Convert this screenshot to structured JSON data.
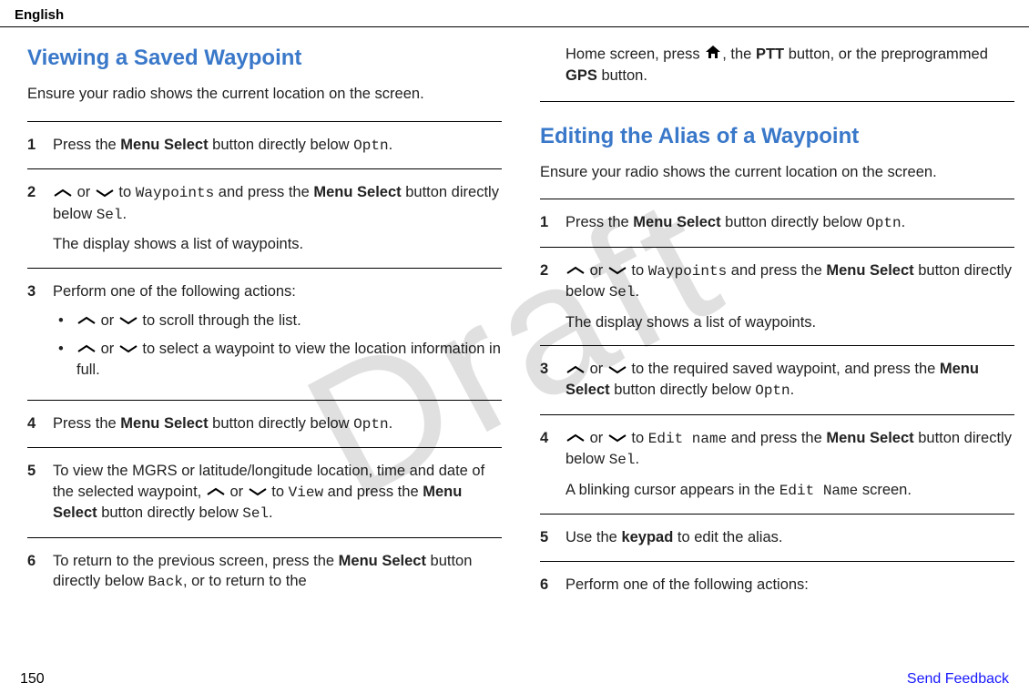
{
  "header": "English",
  "watermark": "Draft",
  "page_number": "150",
  "feedback_link": "Send Feedback",
  "left": {
    "title": "Viewing a Saved Waypoint",
    "intro": "Ensure your radio shows the current location on the screen.",
    "steps": {
      "s1": {
        "num": "1",
        "a1": "Press the ",
        "b1": "Menu Select",
        "a2": " button directly below ",
        "m1": "Optn",
        "a3": "."
      },
      "s2": {
        "num": "2",
        "a1": " or ",
        "a2": " to ",
        "m1": "Waypoints",
        "a3": " and press the ",
        "b1": "Menu Select",
        "a4": " button directly below ",
        "m2": "Sel",
        "a5": ".",
        "sub": "The display shows a list of waypoints."
      },
      "s3": {
        "num": "3",
        "intro": "Perform one of the following actions:",
        "b1a": " or ",
        "b1b": " to scroll through the list.",
        "b2a": " or ",
        "b2b": " to select a waypoint to view the location information in full."
      },
      "s4": {
        "num": "4",
        "a1": "Press the ",
        "b1": "Menu Select",
        "a2": " button directly below ",
        "m1": "Optn",
        "a3": "."
      },
      "s5": {
        "num": "5",
        "a1": "To view the MGRS or latitude/longitude location, time and date of the selected waypoint, ",
        "a2": " or ",
        "a3": " to ",
        "m1": "View",
        "a4": " and press the ",
        "b1": "Menu Select",
        "a5": " button directly below ",
        "m2": "Sel",
        "a6": "."
      },
      "s6": {
        "num": "6",
        "a1": "To return to the previous screen, press the ",
        "b1": "Menu Select",
        "a2": " button directly below ",
        "m1": "Back",
        "a3": ", or to return to the"
      }
    }
  },
  "right": {
    "cont": {
      "a1": "Home screen, press ",
      "a2": ", the ",
      "b1": "PTT",
      "a3": " button, or the preprogrammed ",
      "b2": "GPS",
      "a4": " button."
    },
    "title": "Editing the Alias of a Waypoint",
    "intro": "Ensure your radio shows the current location on the screen.",
    "steps": {
      "s1": {
        "num": "1",
        "a1": "Press the ",
        "b1": "Menu Select",
        "a2": " button directly below ",
        "m1": "Optn",
        "a3": "."
      },
      "s2": {
        "num": "2",
        "a1": " or ",
        "a2": " to ",
        "m1": "Waypoints",
        "a3": " and press the ",
        "b1": "Menu Select",
        "a4": " button directly below ",
        "m2": "Sel",
        "a5": ".",
        "sub": "The display shows a list of waypoints."
      },
      "s3": {
        "num": "3",
        "a1": " or ",
        "a2": " to the required saved waypoint, and press the ",
        "b1": "Menu Select",
        "a3": " button directly below ",
        "m1": "Optn",
        "a4": "."
      },
      "s4": {
        "num": "4",
        "a1": " or ",
        "a2": " to ",
        "m1": "Edit name",
        "a3": " and press the ",
        "b1": "Menu Select",
        "a4": " button directly below ",
        "m2": "Sel",
        "a5": ".",
        "sub1": "A blinking cursor appears in the ",
        "m3": "Edit Name",
        "sub2": " screen."
      },
      "s5": {
        "num": "5",
        "a1": "Use the ",
        "b1": "keypad",
        "a2": " to edit the alias."
      },
      "s6": {
        "num": "6",
        "a1": "Perform one of the following actions:"
      }
    }
  }
}
